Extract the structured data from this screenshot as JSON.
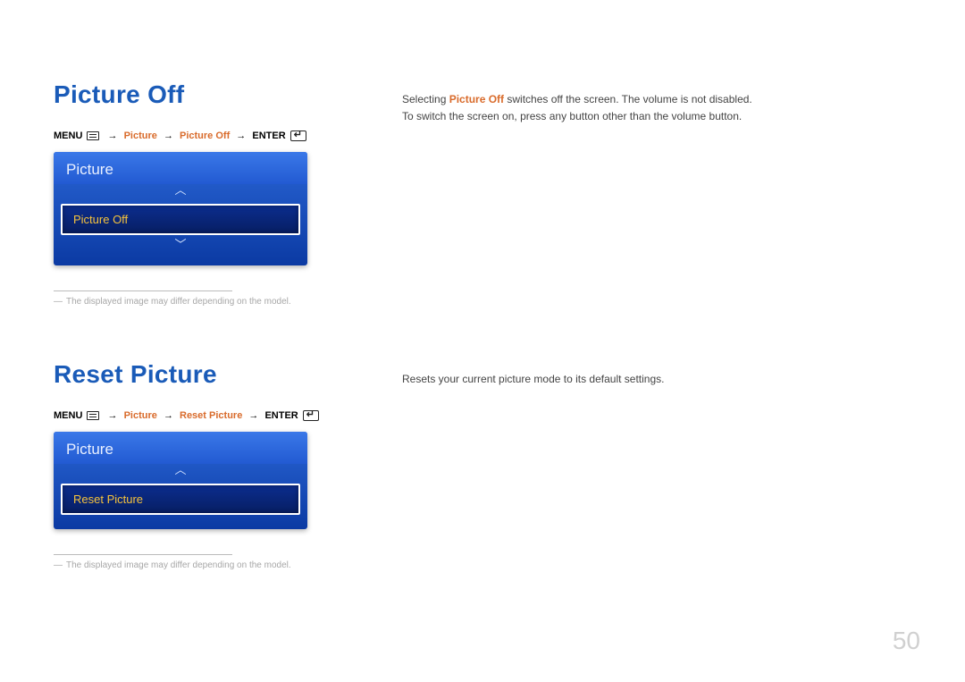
{
  "page_number": "50",
  "section1": {
    "title": "Picture Off",
    "menu_label": "MENU",
    "path_picture": "Picture",
    "path_item": "Picture Off",
    "enter_label": "ENTER",
    "osd_header": "Picture",
    "osd_selected": "Picture Off",
    "footnote": "The displayed image may differ depending on the model.",
    "desc_pre": "Selecting ",
    "desc_bold": "Picture Off",
    "desc_post": " switches off the screen. The volume is not disabled.",
    "desc_line2": "To switch the screen on, press any button other than the volume button."
  },
  "section2": {
    "title": "Reset Picture",
    "menu_label": "MENU",
    "path_picture": "Picture",
    "path_item": "Reset Picture",
    "enter_label": "ENTER",
    "osd_header": "Picture",
    "osd_selected": "Reset Picture",
    "footnote": "The displayed image may differ depending on the model.",
    "desc": "Resets your current picture mode to its default settings."
  }
}
